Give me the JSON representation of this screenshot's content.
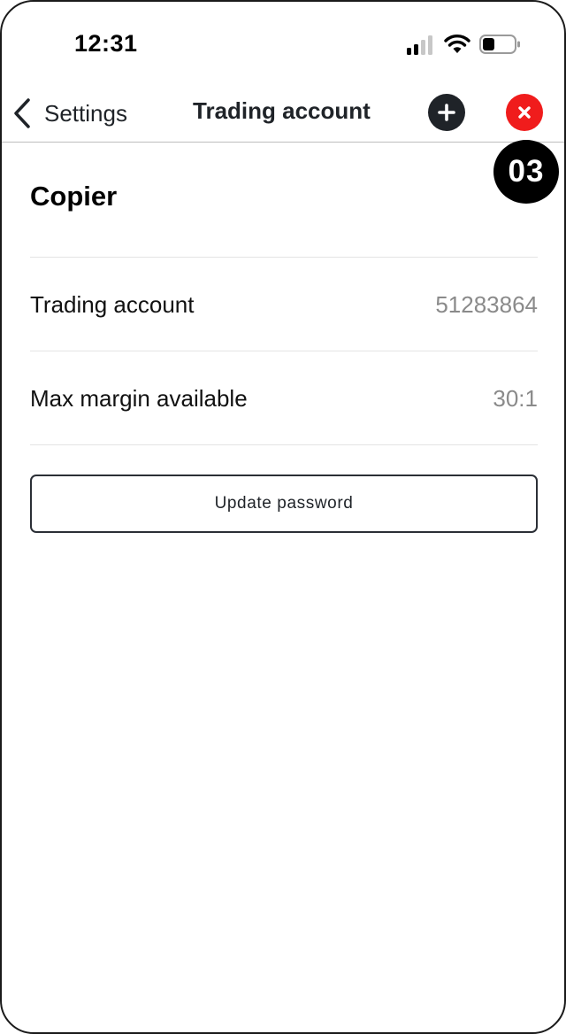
{
  "status_bar": {
    "time": "12:31",
    "icons": [
      "signal-icon",
      "wifi-icon",
      "battery-icon"
    ]
  },
  "nav": {
    "back_label": "Settings",
    "back_icon": "chevron-left-icon",
    "title": "Trading account",
    "add_icon": "plus-icon",
    "close_icon": "close-icon"
  },
  "step_badge": "03",
  "section": {
    "title": "Copier"
  },
  "rows": [
    {
      "label": "Trading account",
      "value": "51283864"
    },
    {
      "label": "Max margin available",
      "value": "30:1"
    }
  ],
  "update_button_label": "Update password",
  "colors": {
    "text_dark": "#1f2328",
    "value_grey": "#8a8a8a",
    "close_red": "#f01c1c",
    "add_dark": "#1f2328",
    "badge_black": "#000000"
  }
}
